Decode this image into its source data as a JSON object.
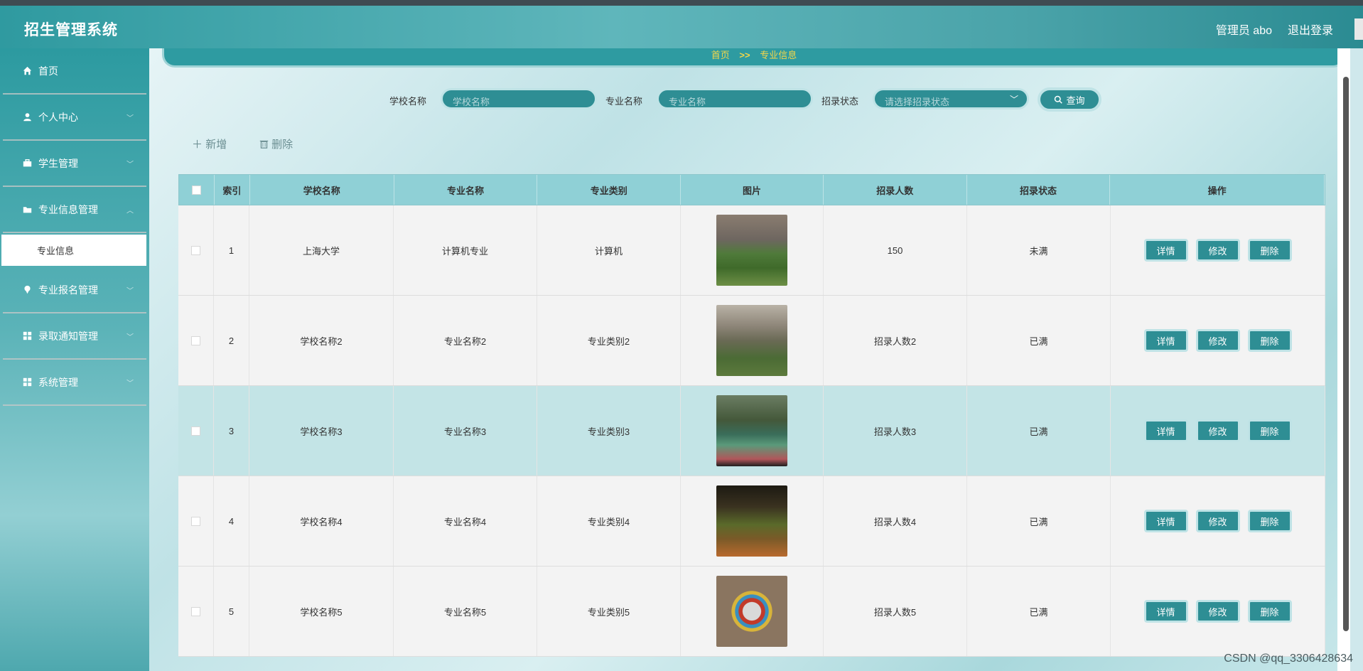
{
  "header": {
    "title": "招生管理系统",
    "user": "管理员 abo",
    "logout": "退出登录"
  },
  "sidebar": {
    "items": [
      {
        "label": "首页",
        "icon": "home-icon",
        "has_children": false
      },
      {
        "label": "个人中心",
        "icon": "user-icon",
        "has_children": true
      },
      {
        "label": "学生管理",
        "icon": "briefcase-icon",
        "has_children": true
      },
      {
        "label": "专业信息管理",
        "icon": "folder-icon",
        "has_children": true,
        "sub": [
          "专业信息"
        ]
      },
      {
        "label": "专业报名管理",
        "icon": "pin-icon",
        "has_children": true
      },
      {
        "label": "录取通知管理",
        "icon": "grid-icon",
        "has_children": true
      },
      {
        "label": "系统管理",
        "icon": "grid-icon",
        "has_children": true
      }
    ]
  },
  "breadcrumb": {
    "home": "首页",
    "sep": ">>",
    "current": "专业信息"
  },
  "search": {
    "school_label": "学校名称",
    "school_placeholder": "学校名称",
    "major_label": "专业名称",
    "major_placeholder": "专业名称",
    "status_label": "招录状态",
    "status_placeholder": "请选择招录状态",
    "query_button": "查询"
  },
  "toolbar": {
    "add": "新增",
    "delete": "删除"
  },
  "table": {
    "columns": [
      "索引",
      "学校名称",
      "专业名称",
      "专业类别",
      "图片",
      "招录人数",
      "招录状态",
      "操作"
    ],
    "rows": [
      {
        "index": "1",
        "school": "上海大学",
        "major": "计算机专业",
        "category": "计算机",
        "count": "150",
        "status": "未满"
      },
      {
        "index": "2",
        "school": "学校名称2",
        "major": "专业名称2",
        "category": "专业类别2",
        "count": "招录人数2",
        "status": "已满"
      },
      {
        "index": "3",
        "school": "学校名称3",
        "major": "专业名称3",
        "category": "专业类别3",
        "count": "招录人数3",
        "status": "已满"
      },
      {
        "index": "4",
        "school": "学校名称4",
        "major": "专业名称4",
        "category": "专业类别4",
        "count": "招录人数4",
        "status": "已满"
      },
      {
        "index": "5",
        "school": "学校名称5",
        "major": "专业名称5",
        "category": "专业类别5",
        "count": "招录人数5",
        "status": "已满"
      }
    ],
    "actions": {
      "detail": "详情",
      "edit": "修改",
      "delete": "删除"
    }
  },
  "watermark": "CSDN @qq_3306428634"
}
